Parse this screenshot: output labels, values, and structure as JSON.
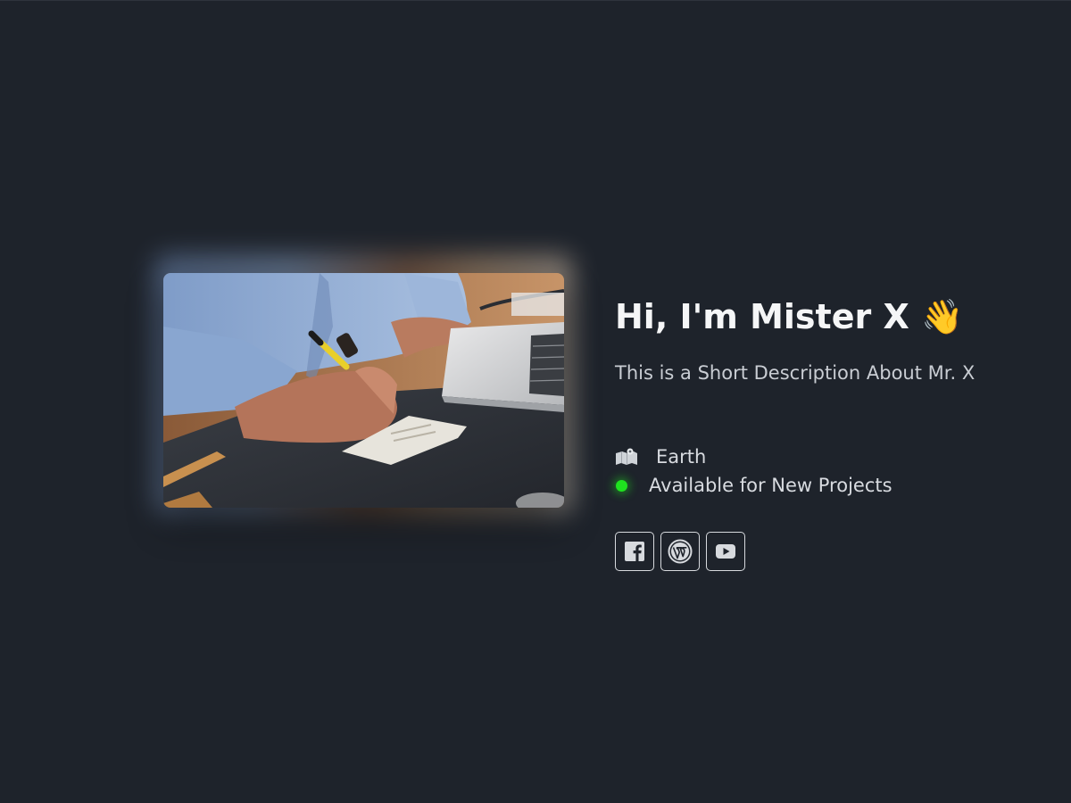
{
  "profile": {
    "title": "Hi, I'm Mister X 👋",
    "description": "This is a Short Description About Mr. X",
    "location": "Earth",
    "status": "Available for New Projects",
    "status_color": "#1fe21f"
  },
  "hero": {
    "image_subject": "person writing on paper next to a laptop"
  },
  "socials": [
    {
      "name": "facebook",
      "icon": "facebook-icon"
    },
    {
      "name": "wordpress",
      "icon": "wordpress-icon"
    },
    {
      "name": "youtube",
      "icon": "youtube-icon"
    }
  ],
  "colors": {
    "background": "#1e232b",
    "title": "#f5f6f7",
    "text": "#c9cdd3"
  }
}
